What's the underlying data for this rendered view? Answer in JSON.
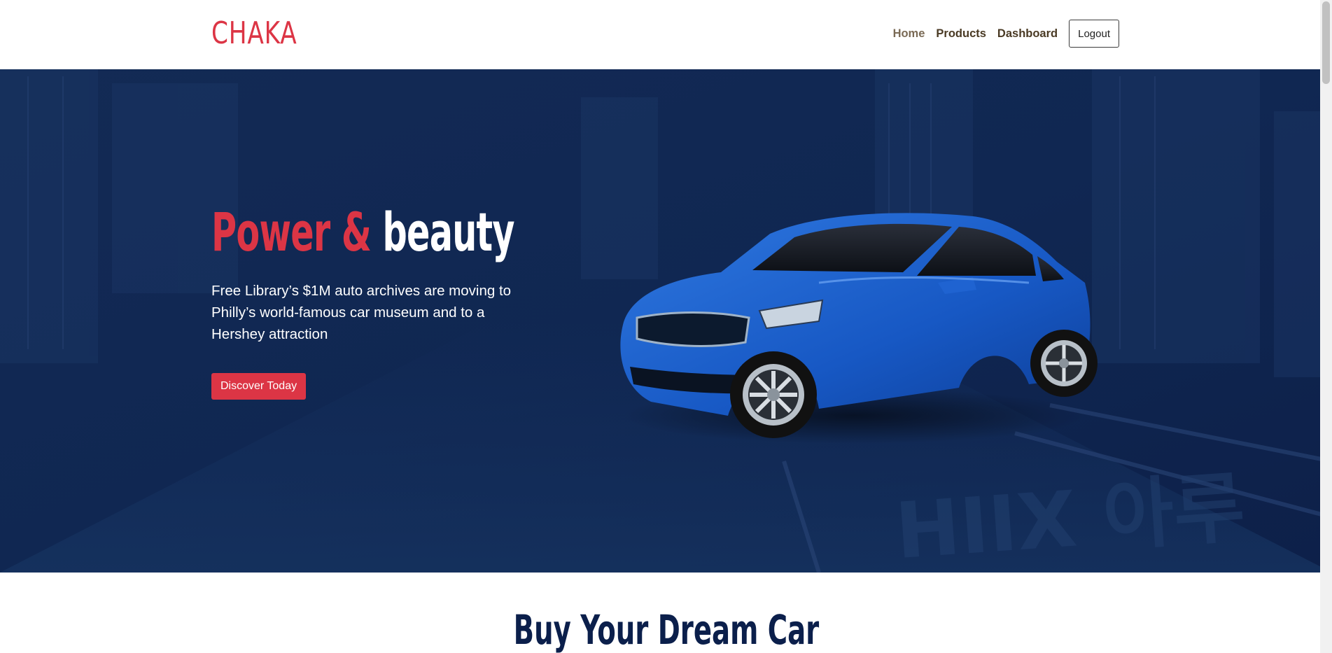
{
  "colors": {
    "brand_red": "#dc3545",
    "navy": "#0f2550",
    "nav_dark": "#4a3a24",
    "nav_active": "#7a6a55",
    "heading_navy": "#0b1f4b"
  },
  "navbar": {
    "brand": "CHAKA",
    "links": [
      {
        "label": "Home"
      },
      {
        "label": "Products"
      },
      {
        "label": "Dashboard"
      }
    ],
    "logout_label": "Logout"
  },
  "hero": {
    "title_part1": "Power &",
    "title_part2": "beauty",
    "description": "Free Library’s $1M auto archives are moving to Philly’s world-famous car museum and to a Hershey attraction",
    "cta_label": "Discover Today",
    "image_icon": "blue-sedan-car"
  },
  "section": {
    "title": "Buy Your Dream Car"
  }
}
